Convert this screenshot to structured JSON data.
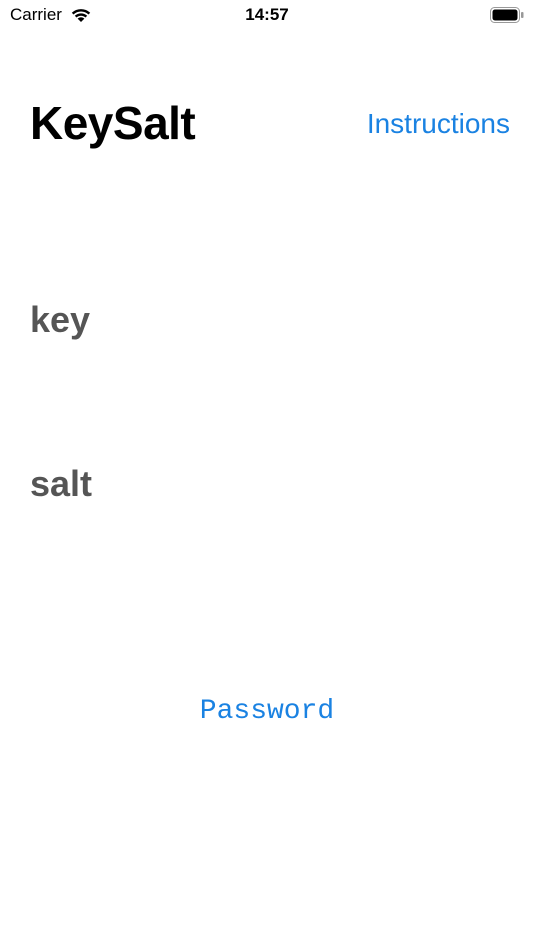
{
  "status_bar": {
    "carrier": "Carrier",
    "time": "14:57"
  },
  "header": {
    "title": "KeySalt",
    "instructions_label": "Instructions"
  },
  "form": {
    "key_placeholder": "key",
    "salt_placeholder": "salt"
  },
  "actions": {
    "password_label": "Password"
  },
  "colors": {
    "accent": "#1a82e2",
    "placeholder": "#555555"
  }
}
